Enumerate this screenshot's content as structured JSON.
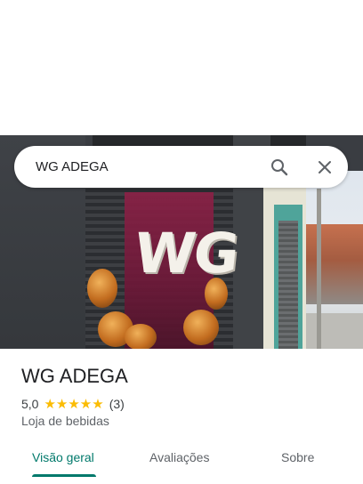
{
  "search": {
    "query": "WG ADEGA"
  },
  "icons": {
    "search": "search-icon",
    "close": "close-icon"
  },
  "photo": {
    "sign_text": "WG"
  },
  "place": {
    "title": "WG ADEGA",
    "rating": "5,0",
    "stars": "★★★★★",
    "review_count": "(3)",
    "category": "Loja de bebidas"
  },
  "tabs": [
    {
      "label": "Visão geral",
      "active": true
    },
    {
      "label": "Avaliações",
      "active": false
    },
    {
      "label": "Sobre",
      "active": false
    }
  ],
  "colors": {
    "accent": "#00796b",
    "star": "#fbbc04"
  }
}
